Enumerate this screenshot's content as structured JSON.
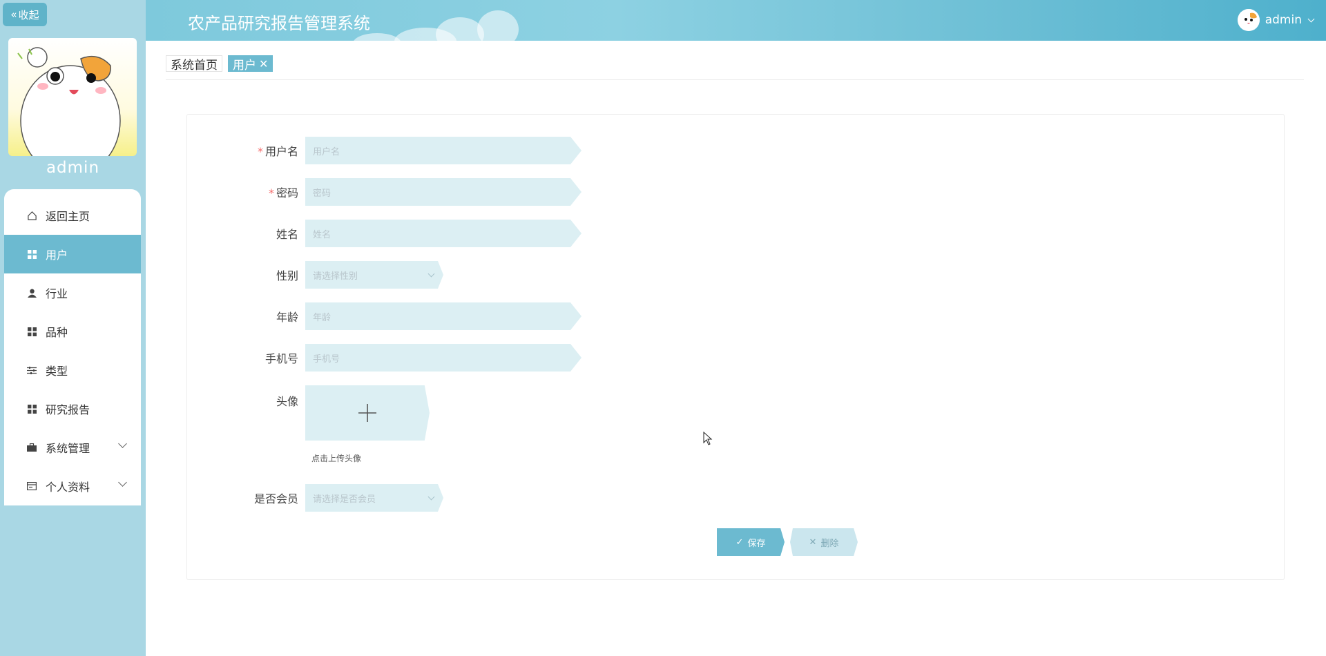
{
  "app": {
    "title": "农产品研究报告管理系统",
    "collapse_label": "收起",
    "user": "admin"
  },
  "sidebar": {
    "profile_name": "admin",
    "items": [
      {
        "label": "返回主页",
        "icon": "home-icon"
      },
      {
        "label": "用户",
        "icon": "grid-icon",
        "active": true
      },
      {
        "label": "行业",
        "icon": "person-icon"
      },
      {
        "label": "品种",
        "icon": "grid-icon"
      },
      {
        "label": "类型",
        "icon": "sliders-icon"
      },
      {
        "label": "研究报告",
        "icon": "grid-icon"
      },
      {
        "label": "系统管理",
        "icon": "briefcase-icon",
        "expandable": true
      },
      {
        "label": "个人资料",
        "icon": "id-card-icon",
        "expandable": true
      }
    ]
  },
  "tabs": [
    {
      "label": "系统首页"
    },
    {
      "label": "用户",
      "active": true,
      "closable": true
    }
  ],
  "form": {
    "username": {
      "label": "用户名",
      "placeholder": "用户名",
      "required": true
    },
    "password": {
      "label": "密码",
      "placeholder": "密码",
      "required": true
    },
    "name": {
      "label": "姓名",
      "placeholder": "姓名"
    },
    "gender": {
      "label": "性别",
      "placeholder": "请选择性别"
    },
    "age": {
      "label": "年龄",
      "placeholder": "年龄"
    },
    "phone": {
      "label": "手机号",
      "placeholder": "手机号"
    },
    "avatar": {
      "label": "头像",
      "hint": "点击上传头像"
    },
    "member": {
      "label": "是否会员",
      "placeholder": "请选择是否会员"
    }
  },
  "buttons": {
    "save": "保存",
    "delete": "删除"
  },
  "colors": {
    "accent": "#6cbad0",
    "sidebar_bg": "#a9d7e4",
    "input_bg": "#dceff3",
    "required": "#f56c6c"
  }
}
